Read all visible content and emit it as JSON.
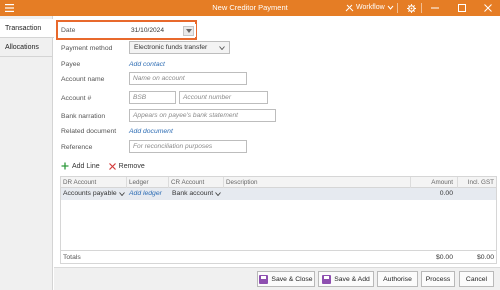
{
  "window": {
    "title": "New Creditor Payment",
    "workflow_label": "Workflow",
    "accent": "#e57d25"
  },
  "tabs": [
    {
      "label": "Transaction"
    },
    {
      "label": "Allocations"
    }
  ],
  "form": {
    "date_label": "Date",
    "date_value": "31/10/2024",
    "payment_method_label": "Payment method",
    "payment_method_value": "Electronic funds transfer",
    "payee_label": "Payee",
    "add_contact": "Add contact",
    "account_name_label": "Account name",
    "account_name_placeholder": "Name on account",
    "account_num_label": "Account #",
    "bsb_placeholder": "BSB",
    "account_number_placeholder": "Account number",
    "bank_narration_label": "Bank narration",
    "bank_narration_placeholder": "Appears on payee's bank statement",
    "related_doc_label": "Related document",
    "add_document": "Add document",
    "reference_label": "Reference",
    "reference_placeholder": "For reconciliation purposes"
  },
  "grid": {
    "add_line": "Add Line",
    "remove": "Remove",
    "headers": {
      "dr_account": "DR Account",
      "ledger": "Ledger",
      "cr_account": "CR Account",
      "description": "Description",
      "amount": "Amount",
      "incl_gst": "Incl. GST"
    },
    "row": {
      "dr_account": "Accounts payable",
      "ledger": "Add ledger",
      "cr_account": "Bank account",
      "amount": "0.00"
    },
    "totals_label": "Totals",
    "totals_amount": "$0.00",
    "totals_gst": "$0.00"
  },
  "buttons": {
    "save_close": "Save & Close",
    "save_add": "Save & Add",
    "authorise": "Authorise",
    "process": "Process",
    "cancel": "Cancel"
  },
  "icons": [
    "menu-icon",
    "workflow-icon",
    "settings-icon",
    "minimize-icon",
    "maximize-icon",
    "close-icon",
    "dropdown-arrow-icon",
    "add-icon",
    "remove-icon",
    "save-icon"
  ]
}
